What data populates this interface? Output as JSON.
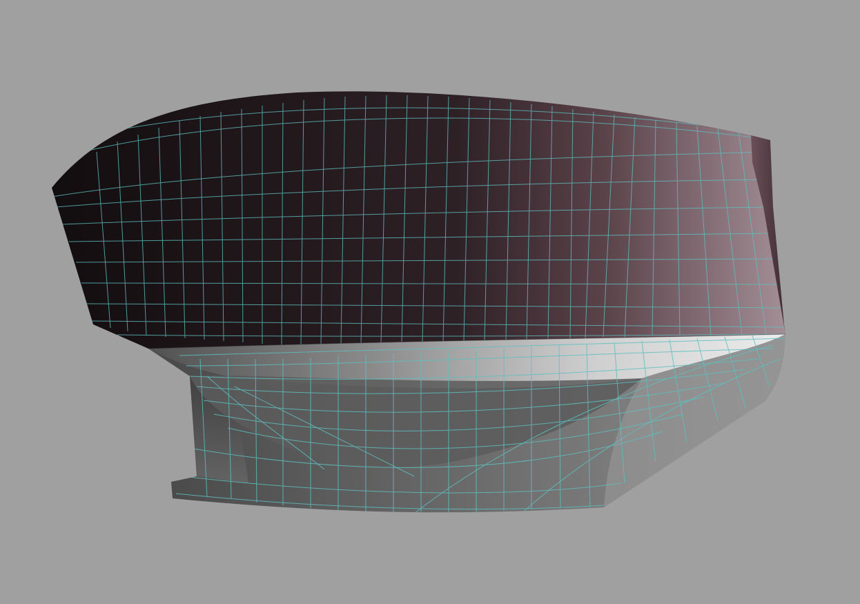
{
  "scene": {
    "background_color": "#a0a0a0",
    "object": "hull-model",
    "topsides_colors": [
      "#120d0f",
      "#2e2126",
      "#5a4249",
      "#a48f96"
    ],
    "underbody_colors": [
      "#5a5a5a",
      "#8c8c8c",
      "#d8d8d8"
    ],
    "bottom_colors": [
      "#4e4e4e",
      "#6a6a6a",
      "#8a8a8a"
    ],
    "wireframe_color": "#5fbfbf"
  }
}
